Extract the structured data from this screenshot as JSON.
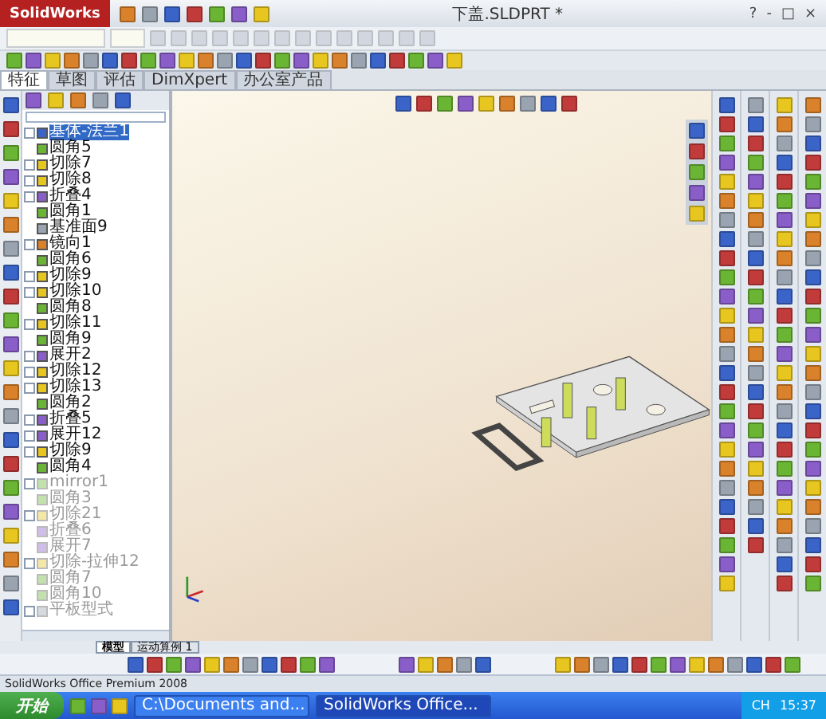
{
  "app": {
    "logo": "SolidWorks",
    "title": "下盖.SLDPRT *",
    "window_buttons": [
      "?",
      "-",
      "□",
      "×"
    ]
  },
  "tabs": [
    {
      "label": "特征",
      "selected": true
    },
    {
      "label": "草图",
      "selected": false
    },
    {
      "label": "评估",
      "selected": false
    },
    {
      "label": "DimXpert",
      "selected": false
    },
    {
      "label": "办公室产品",
      "selected": false
    }
  ],
  "tree": [
    {
      "label": "基体-法兰1",
      "kind": "flange",
      "expandable": true,
      "suppressed": false,
      "selected": true
    },
    {
      "label": "圆角5",
      "kind": "fillet",
      "expandable": false,
      "suppressed": false,
      "selected": false
    },
    {
      "label": "切除7",
      "kind": "cut",
      "expandable": true,
      "suppressed": false,
      "selected": false
    },
    {
      "label": "切除8",
      "kind": "cut",
      "expandable": true,
      "suppressed": false,
      "selected": false
    },
    {
      "label": "折叠4",
      "kind": "fold",
      "expandable": true,
      "suppressed": false,
      "selected": false
    },
    {
      "label": "圆角1",
      "kind": "fillet",
      "expandable": false,
      "suppressed": false,
      "selected": false
    },
    {
      "label": "基准面9",
      "kind": "plane",
      "expandable": false,
      "suppressed": false,
      "selected": false
    },
    {
      "label": "镜向1",
      "kind": "mirror",
      "expandable": true,
      "suppressed": false,
      "selected": false
    },
    {
      "label": "圆角6",
      "kind": "fillet",
      "expandable": false,
      "suppressed": false,
      "selected": false
    },
    {
      "label": "切除9",
      "kind": "cut",
      "expandable": true,
      "suppressed": false,
      "selected": false
    },
    {
      "label": "切除10",
      "kind": "cut",
      "expandable": true,
      "suppressed": false,
      "selected": false
    },
    {
      "label": "圆角8",
      "kind": "fillet",
      "expandable": false,
      "suppressed": false,
      "selected": false
    },
    {
      "label": "切除11",
      "kind": "cut",
      "expandable": true,
      "suppressed": false,
      "selected": false
    },
    {
      "label": "圆角9",
      "kind": "fillet",
      "expandable": false,
      "suppressed": false,
      "selected": false
    },
    {
      "label": "展开2",
      "kind": "fold",
      "expandable": true,
      "suppressed": false,
      "selected": false
    },
    {
      "label": "切除12",
      "kind": "cut",
      "expandable": true,
      "suppressed": false,
      "selected": false
    },
    {
      "label": "切除13",
      "kind": "cut",
      "expandable": true,
      "suppressed": false,
      "selected": false
    },
    {
      "label": "圆角2",
      "kind": "fillet",
      "expandable": false,
      "suppressed": false,
      "selected": false
    },
    {
      "label": "折叠5",
      "kind": "fold",
      "expandable": true,
      "suppressed": false,
      "selected": false
    },
    {
      "label": "展开12",
      "kind": "fold",
      "expandable": true,
      "suppressed": false,
      "selected": false
    },
    {
      "label": "切除9",
      "kind": "cut",
      "expandable": true,
      "suppressed": false,
      "selected": false
    },
    {
      "label": "圆角4",
      "kind": "fillet",
      "expandable": false,
      "suppressed": false,
      "selected": false
    },
    {
      "label": "mirror1",
      "kind": "fillet",
      "expandable": true,
      "suppressed": true,
      "selected": false
    },
    {
      "label": "圆角3",
      "kind": "fillet",
      "expandable": false,
      "suppressed": true,
      "selected": false
    },
    {
      "label": "切除21",
      "kind": "cut",
      "expandable": true,
      "suppressed": true,
      "selected": false
    },
    {
      "label": "折叠6",
      "kind": "fold",
      "expandable": false,
      "suppressed": true,
      "selected": false
    },
    {
      "label": "展开7",
      "kind": "fold",
      "expandable": false,
      "suppressed": true,
      "selected": false
    },
    {
      "label": "切除-拉伸12",
      "kind": "cut",
      "expandable": true,
      "suppressed": true,
      "selected": false
    },
    {
      "label": "圆角7",
      "kind": "fillet",
      "expandable": false,
      "suppressed": true,
      "selected": false
    },
    {
      "label": "圆角10",
      "kind": "fillet",
      "expandable": false,
      "suppressed": true,
      "selected": false
    },
    {
      "label": "平板型式",
      "kind": "plane",
      "expandable": true,
      "suppressed": true,
      "selected": false
    }
  ],
  "bottom_tabs": [
    {
      "label": "模型",
      "selected": true
    },
    {
      "label": "运动算例 1",
      "selected": false
    }
  ],
  "status_bar": "SolidWorks Office Premium 2008",
  "taskbar": {
    "start": "开始",
    "tasks": [
      {
        "label": "C:\\Documents and...",
        "selected": false
      },
      {
        "label": "SolidWorks Office...",
        "selected": true
      }
    ],
    "lang": "CH",
    "clock": "15:37"
  }
}
